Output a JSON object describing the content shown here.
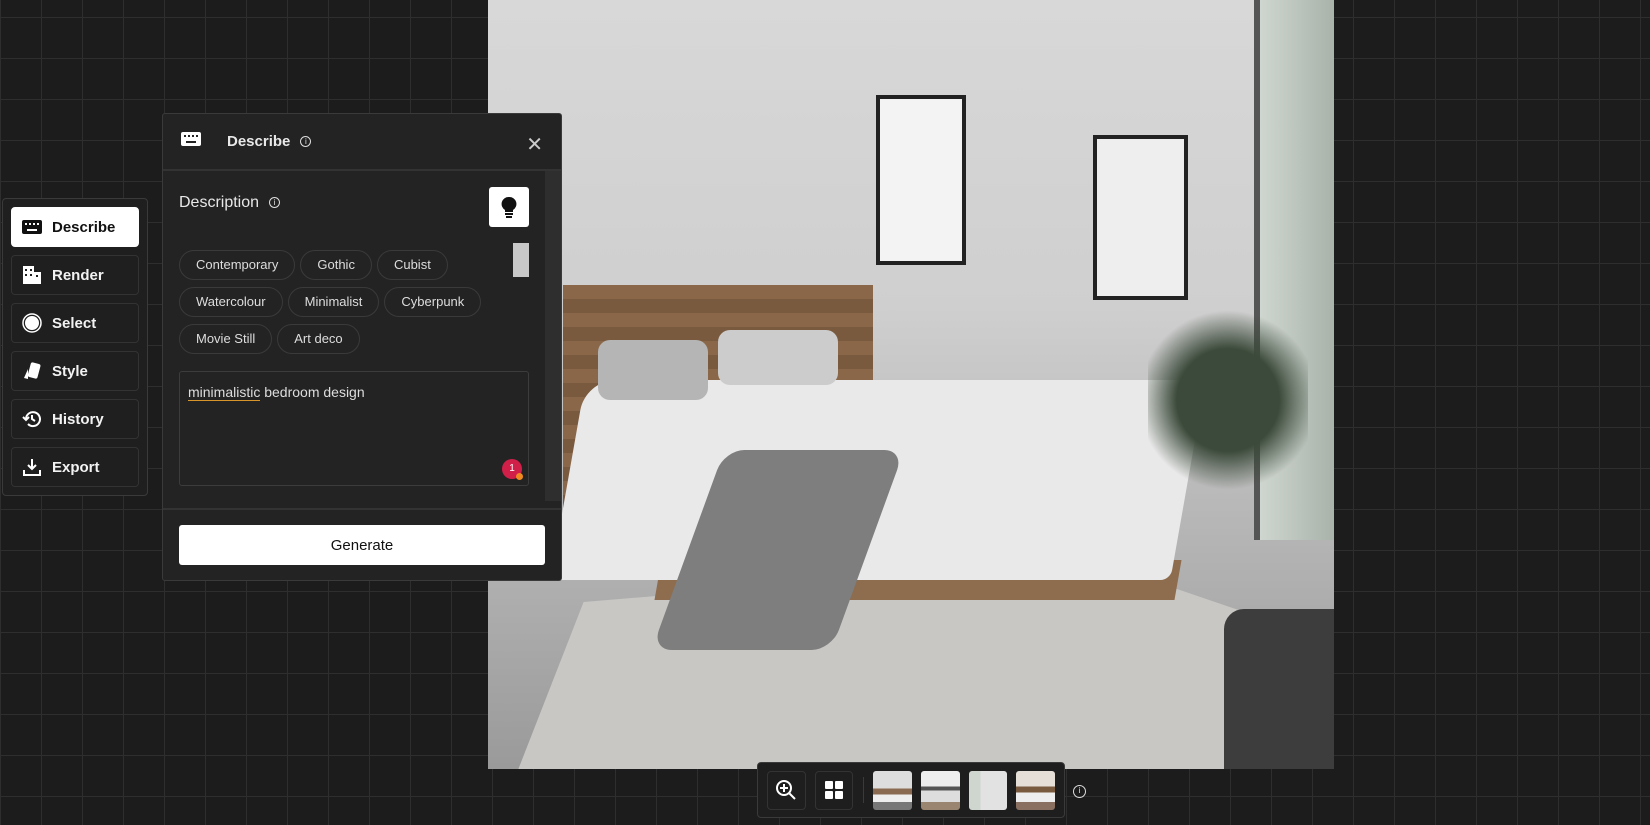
{
  "sidebar": {
    "items": [
      {
        "label": "Describe",
        "icon": "keyboard-icon",
        "active": true
      },
      {
        "label": "Render",
        "icon": "building-icon"
      },
      {
        "label": "Select",
        "icon": "circle-select-icon"
      },
      {
        "label": "Style",
        "icon": "style-cards-icon"
      },
      {
        "label": "History",
        "icon": "history-icon"
      },
      {
        "label": "Export",
        "icon": "download-icon"
      }
    ]
  },
  "panel": {
    "title": "Describe",
    "section": "Description",
    "chips": [
      "Contemporary",
      "Gothic",
      "Cubist",
      "Watercolour",
      "Minimalist",
      "Cyberpunk",
      "Movie Still",
      "Art deco"
    ],
    "prompt_underlined": "minimalistic",
    "prompt_rest": " bedroom design",
    "badge_count": "1",
    "generate_label": "Generate"
  },
  "tray": {
    "thumbnails": 4
  },
  "colors": {
    "accent_underline": "#d8962a",
    "badge": "#d0204a"
  }
}
